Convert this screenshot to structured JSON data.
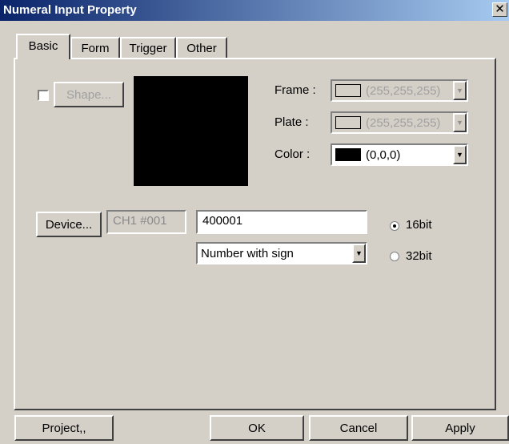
{
  "window": {
    "title": "Numeral Input Property",
    "close_icon": "close-icon"
  },
  "tabs": [
    {
      "label": "Basic",
      "active": true
    },
    {
      "label": "Form",
      "active": false
    },
    {
      "label": "Trigger",
      "active": false
    },
    {
      "label": "Other",
      "active": false
    }
  ],
  "shape": {
    "checked": false,
    "button_label": "Shape...",
    "preview_color": "#000000"
  },
  "frame": {
    "label": "Frame :",
    "value": "(255,255,255)",
    "swatch_color": "#d4d0c8",
    "enabled": false
  },
  "plate": {
    "label": "Plate :",
    "value": "(255,255,255)",
    "swatch_color": "#d4d0c8",
    "enabled": false
  },
  "color": {
    "label": "Color :",
    "value": "(0,0,0)",
    "swatch_color": "#000000",
    "enabled": true
  },
  "device": {
    "button_label": "Device...",
    "channel": "CH1 #001",
    "address": "400001",
    "format": "Number with sign"
  },
  "bit_mode": {
    "options": [
      "16bit",
      "32bit"
    ],
    "selected": "16bit"
  },
  "footer": {
    "project": "Project,,",
    "ok": "OK",
    "cancel": "Cancel",
    "apply": "Apply"
  }
}
